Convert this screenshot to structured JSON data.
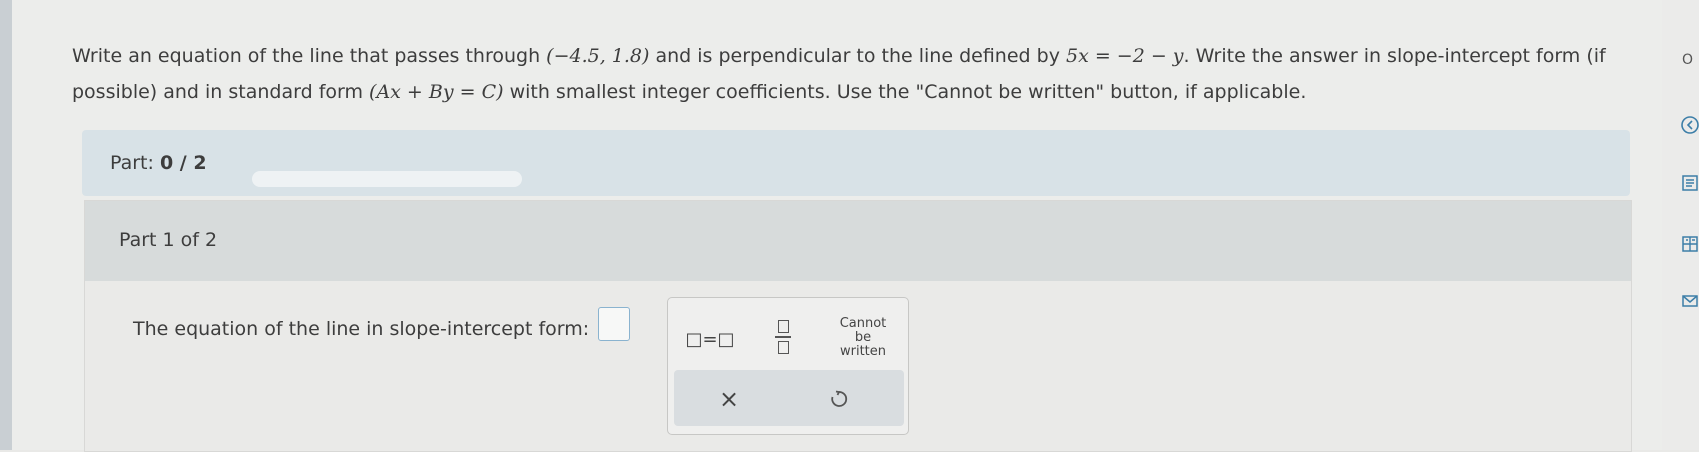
{
  "question": {
    "text_1": "Write an equation of the line that passes through ",
    "point": "(−4.5, 1.8)",
    "text_2": " and is perpendicular to the line defined by ",
    "line_eq": "5x = −2 − y",
    "text_3": ". Write the answer in slope-intercept form (if possible) and in standard form ",
    "standard_form": "(Ax + By = C)",
    "text_4": " with smallest integer coefficients. Use the \"Cannot be written\" button, if applicable."
  },
  "progress": {
    "label": "Part: ",
    "current": "0",
    "separator": " / ",
    "total": "2",
    "fraction": 0
  },
  "part": {
    "header": "Part 1 of 2",
    "prompt": "The equation of the line in slope-intercept form:",
    "answer_value": ""
  },
  "toolbar": {
    "equals_label": "□=□",
    "cannot_be_written": [
      "Cannot",
      "be",
      "written"
    ],
    "clear_label": "×"
  },
  "side": {
    "truncated_label": "O"
  },
  "colors": {
    "accent": "#4d9a46",
    "input_border": "#8ab3cf",
    "part_bar": "#d8e2e7"
  }
}
